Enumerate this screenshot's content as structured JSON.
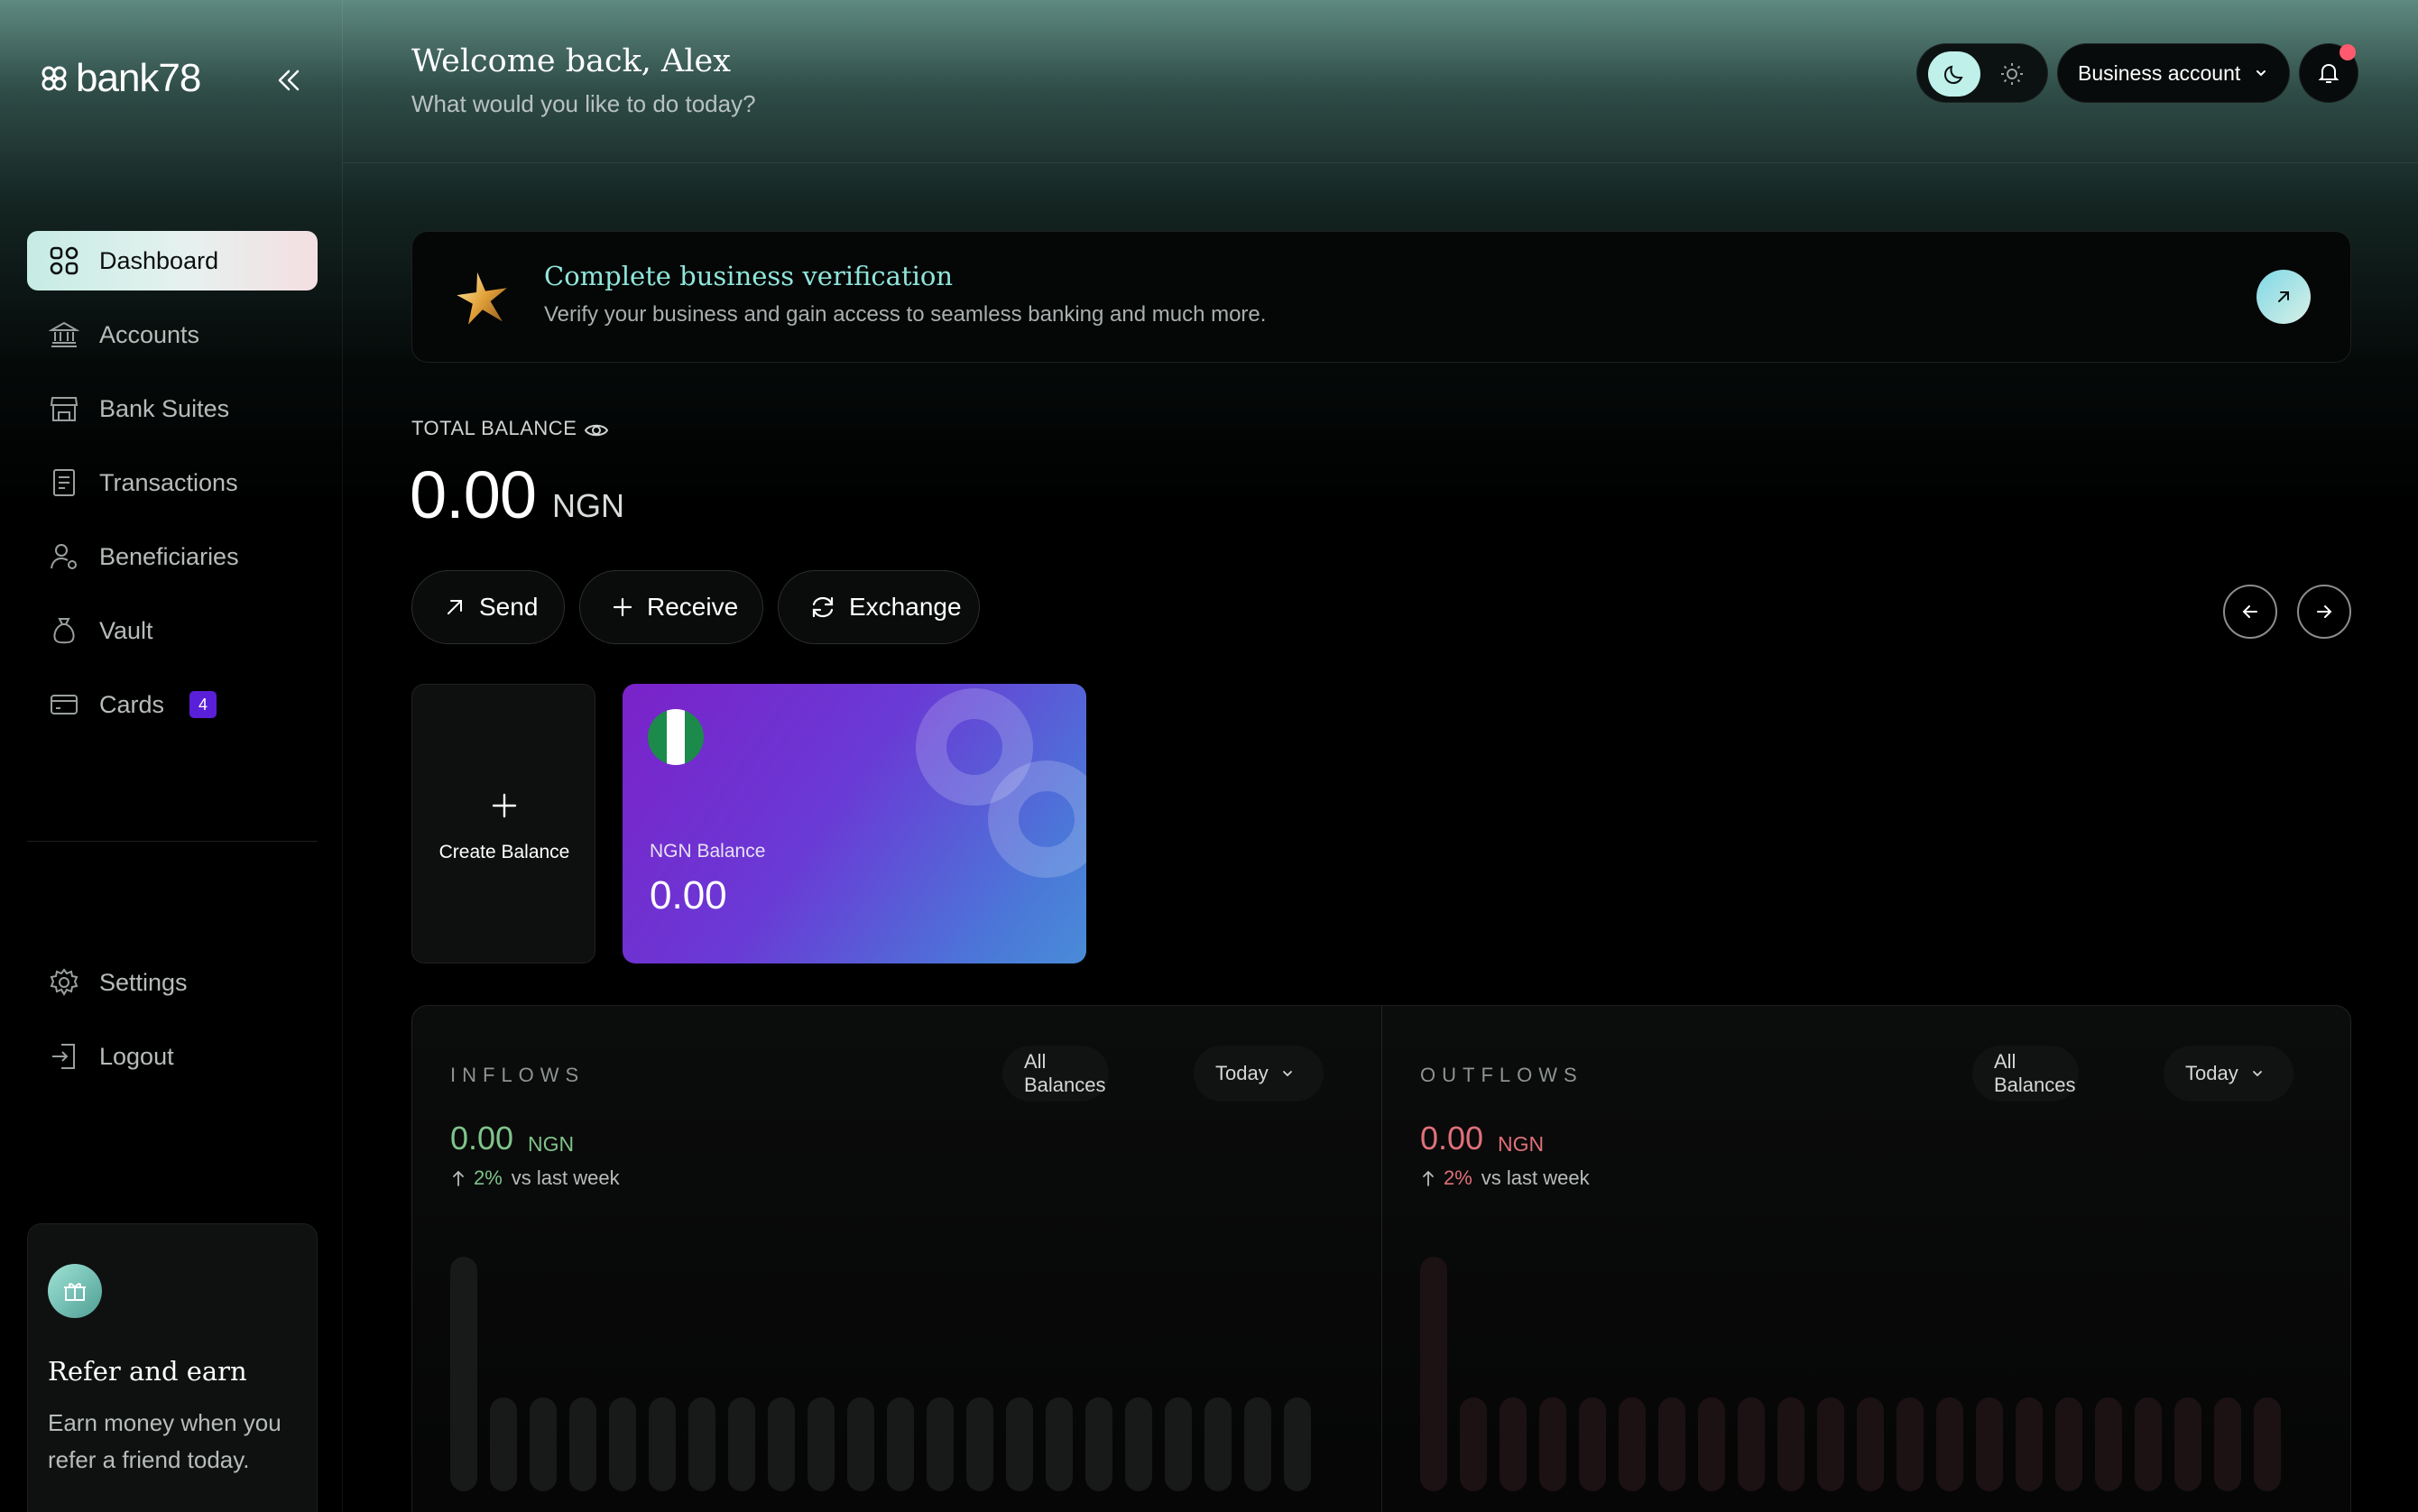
{
  "brand": {
    "name": "bank78"
  },
  "header": {
    "welcome": "Welcome back, Alex",
    "subtitle": "What would you like to do today?",
    "account_label": "Business account",
    "theme": "dark"
  },
  "sidebar": {
    "items": [
      {
        "label": "Dashboard",
        "icon": "grid-icon",
        "active": true
      },
      {
        "label": "Accounts",
        "icon": "bank-icon"
      },
      {
        "label": "Bank Suites",
        "icon": "store-icon"
      },
      {
        "label": "Transactions",
        "icon": "receipt-icon"
      },
      {
        "label": "Beneficiaries",
        "icon": "users-icon"
      },
      {
        "label": "Vault",
        "icon": "bag-icon"
      },
      {
        "label": "Cards",
        "icon": "card-icon",
        "badge": "4"
      }
    ],
    "bottom_items": [
      {
        "label": "Settings",
        "icon": "gear-icon"
      },
      {
        "label": "Logout",
        "icon": "logout-icon"
      }
    ],
    "refer": {
      "title": "Refer and earn",
      "text": "Earn money when you refer a friend today."
    }
  },
  "banner": {
    "title": "Complete business verification",
    "text": "Verify your business and  gain access to seamless banking and much more."
  },
  "balance": {
    "label": "TOTAL BALANCE",
    "amount": "0.00",
    "currency": "NGN"
  },
  "actions": {
    "send": "Send",
    "receive": "Receive",
    "exchange": "Exchange"
  },
  "cards": {
    "create_label": "Create Balance",
    "ngn": {
      "label": "NGN Balance",
      "amount": "0.00"
    }
  },
  "flows": {
    "inflows": {
      "title": "INFLOWS",
      "amount": "0.00",
      "currency": "NGN",
      "change_pct": "2%",
      "change_text": "vs last week",
      "filter_balance": "All Balances",
      "filter_period": "Today",
      "color": "#7fc48a"
    },
    "outflows": {
      "title": "OUTFLOWS",
      "amount": "0.00",
      "currency": "NGN",
      "change_pct": "2%",
      "change_text": "vs last week",
      "filter_balance": "All Balances",
      "filter_period": "Today",
      "color": "#e0707a"
    }
  },
  "colors": {
    "accent": "#8fe6db",
    "badge": "#5a1fd8",
    "notification_dot": "#ff5a6e",
    "card_gradient_start": "#7a22c9",
    "card_gradient_end": "#4a8bd8"
  }
}
